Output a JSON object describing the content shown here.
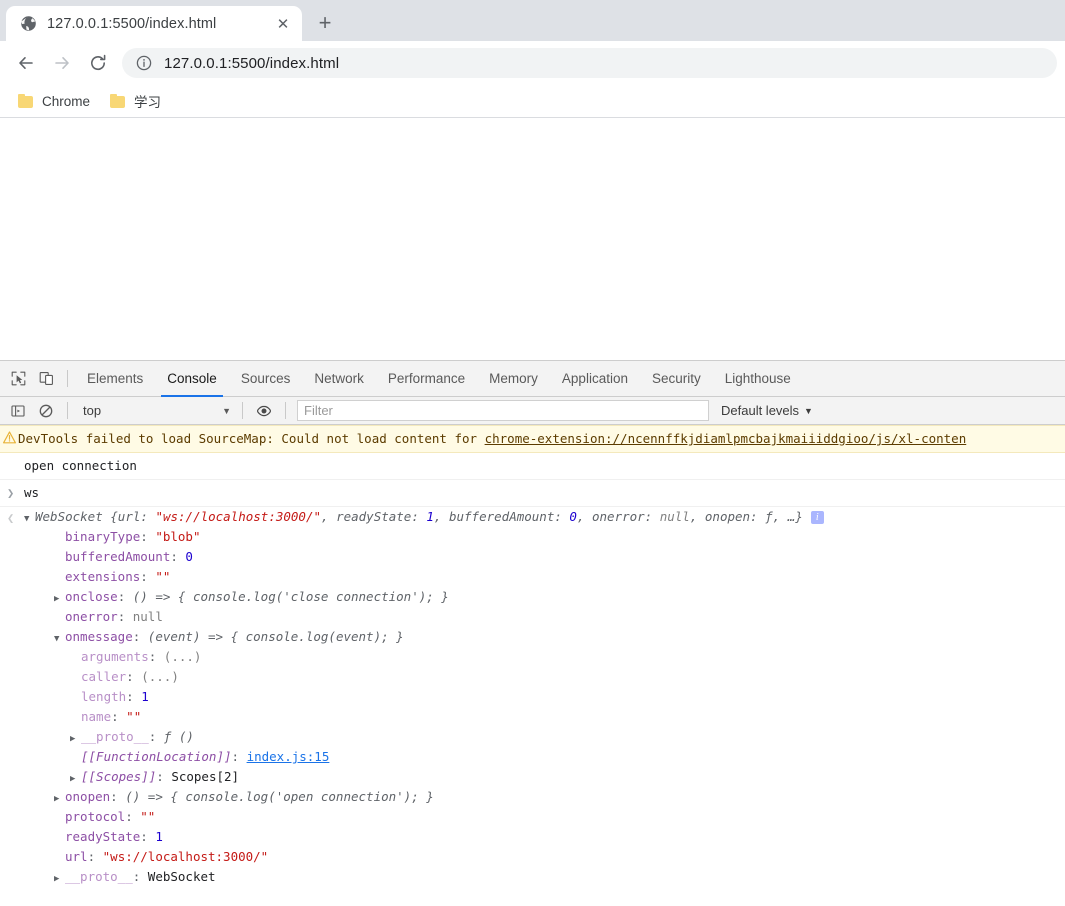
{
  "browser": {
    "tab": {
      "title": "127.0.0.1:5500/index.html",
      "favicon": "globe-icon",
      "close_label": "✕"
    },
    "new_tab_label": "+",
    "nav": {
      "back_label": "←",
      "forward_label": "→",
      "reload_label": "⟳"
    },
    "omnibox": {
      "info_icon": "info-circle-icon",
      "url": "127.0.0.1:5500/index.html"
    },
    "bookmarks": [
      {
        "label": "Chrome",
        "icon": "folder-icon"
      },
      {
        "label": "学习",
        "icon": "folder-icon"
      }
    ]
  },
  "devtools": {
    "inspect_icon": "inspect-element-icon",
    "device_icon": "device-toolbar-icon",
    "tabs": [
      {
        "label": "Elements",
        "active": false
      },
      {
        "label": "Console",
        "active": true
      },
      {
        "label": "Sources",
        "active": false
      },
      {
        "label": "Network",
        "active": false
      },
      {
        "label": "Performance",
        "active": false
      },
      {
        "label": "Memory",
        "active": false
      },
      {
        "label": "Application",
        "active": false
      },
      {
        "label": "Security",
        "active": false
      },
      {
        "label": "Lighthouse",
        "active": false
      }
    ],
    "toolbar": {
      "sidebar_icon": "console-sidebar-icon",
      "clear_icon": "clear-console-icon",
      "context": "top",
      "context_caret": "▼",
      "eye_icon": "live-expression-icon",
      "filter_placeholder": "Filter",
      "filter_value": "",
      "levels_label": "Default levels",
      "levels_caret": "▼"
    },
    "console": {
      "warning": {
        "icon": "warning-triangle-icon",
        "text_before": "DevTools failed to load SourceMap: Could not load content for ",
        "link": "chrome-extension://ncennffkjdiamlpmcbajkmaiiiddgioo/js/xl-conten"
      },
      "log_open": "open connection",
      "input_prompt": "❯",
      "input_expr": "ws",
      "output_prompt": "❮",
      "object": {
        "disclosure": "▼",
        "class_name": "WebSocket",
        "preview": " {url: \"ws://localhost:3000/\", readyState: 1, bufferedAmount: 0, onerror: null, onopen: ƒ, …}",
        "preview_parts": {
          "open_brace": " {",
          "url_key": "url: ",
          "url_val": "\"ws://localhost:3000/\"",
          "sep1": ", ",
          "ready_key": "readyState: ",
          "ready_val": "1",
          "sep2": ", ",
          "buf_key": "bufferedAmount: ",
          "buf_val": "0",
          "sep3": ", ",
          "err_key": "onerror: ",
          "err_val": "null",
          "sep4": ", ",
          "open_key": "onopen: ",
          "open_val": "ƒ",
          "tail": ", …}"
        },
        "info_badge": "i",
        "properties": [
          {
            "indent": 1,
            "tri": "",
            "name": "binaryType",
            "sep": ": ",
            "value": "\"blob\"",
            "vclass": "str"
          },
          {
            "indent": 1,
            "tri": "",
            "name": "bufferedAmount",
            "sep": ": ",
            "value": "0",
            "vclass": "num"
          },
          {
            "indent": 1,
            "tri": "",
            "name": "extensions",
            "sep": ": ",
            "value": "\"\"",
            "vclass": "str"
          },
          {
            "indent": 1,
            "tri": "▶",
            "name": "onclose",
            "sep": ": ",
            "value": "() => { console.log('close connection'); }",
            "vclass": "fn"
          },
          {
            "indent": 1,
            "tri": "",
            "name": "onerror",
            "sep": ": ",
            "value": "null",
            "vclass": "nul"
          },
          {
            "indent": 1,
            "tri": "▼",
            "name": "onmessage",
            "sep": ": ",
            "value": "(event) => { console.log(event); }",
            "vclass": "fn"
          },
          {
            "indent": 2,
            "tri": "",
            "name": "arguments",
            "sep": ": ",
            "value": "(...)",
            "vclass": "nul",
            "dim": true
          },
          {
            "indent": 2,
            "tri": "",
            "name": "caller",
            "sep": ": ",
            "value": "(...)",
            "vclass": "nul",
            "dim": true
          },
          {
            "indent": 2,
            "tri": "",
            "name": "length",
            "sep": ": ",
            "value": "1",
            "vclass": "num",
            "dim": true
          },
          {
            "indent": 2,
            "tri": "",
            "name": "name",
            "sep": ": ",
            "value": "\"\"",
            "vclass": "str",
            "dim": true
          },
          {
            "indent": 2,
            "tri": "▶",
            "name": "__proto__",
            "sep": ": ",
            "value": "ƒ ()",
            "vclass": "fn",
            "dim": true
          },
          {
            "indent": 2,
            "tri": "",
            "name": "[[FunctionLocation]]",
            "sep": ": ",
            "value": "index.js:15",
            "vclass": "srclink",
            "italic": true
          },
          {
            "indent": 2,
            "tri": "▶",
            "name": "[[Scopes]]",
            "sep": ": ",
            "value": "Scopes[2]",
            "vclass": "scopes",
            "italic": true
          },
          {
            "indent": 1,
            "tri": "▶",
            "name": "onopen",
            "sep": ": ",
            "value": "() => { console.log('open connection'); }",
            "vclass": "fn"
          },
          {
            "indent": 1,
            "tri": "",
            "name": "protocol",
            "sep": ": ",
            "value": "\"\"",
            "vclass": "str"
          },
          {
            "indent": 1,
            "tri": "",
            "name": "readyState",
            "sep": ": ",
            "value": "1",
            "vclass": "num"
          },
          {
            "indent": 1,
            "tri": "",
            "name": "url",
            "sep": ": ",
            "value": "\"ws://localhost:3000/\"",
            "vclass": "str"
          },
          {
            "indent": 1,
            "tri": "▶",
            "name": "__proto__",
            "sep": ": ",
            "value": "WebSocket",
            "vclass": "plainval",
            "dim": true
          }
        ]
      }
    }
  },
  "colors": {
    "accent": "#1a73e8",
    "warning_bg": "#fffbe5",
    "string": "#c41a16",
    "number": "#1c00cf",
    "property": "#8d4fa5",
    "tabstrip": "#dee1e6"
  }
}
